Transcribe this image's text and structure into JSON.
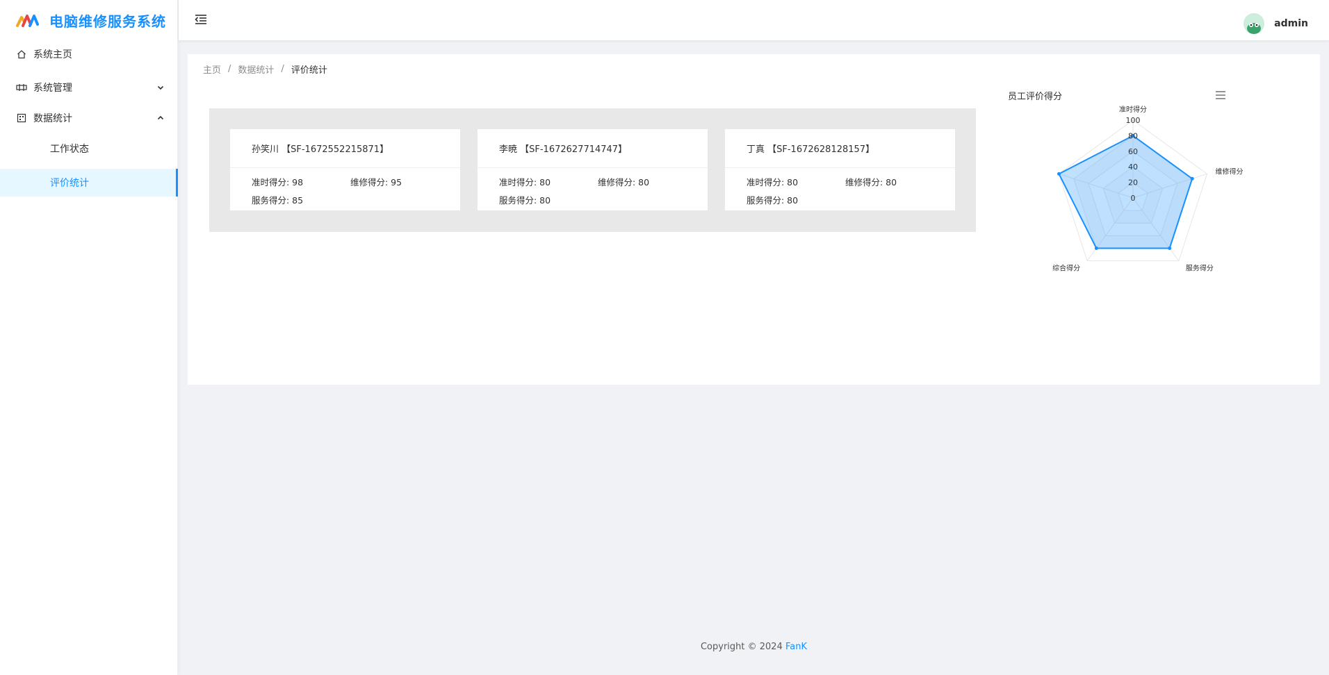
{
  "app": {
    "title": "电脑维修服务系统"
  },
  "sidebar": {
    "items": [
      {
        "label": "系统主页",
        "icon": "home-icon"
      },
      {
        "label": "系统管理",
        "icon": "settings-icon"
      },
      {
        "label": "数据统计",
        "icon": "stats-icon"
      }
    ],
    "sub_items": [
      {
        "label": "工作状态"
      },
      {
        "label": "评价统计"
      }
    ]
  },
  "header": {
    "username": "admin",
    "avatar_icon": "avatar-icon"
  },
  "breadcrumb": {
    "items": [
      "主页",
      "数据统计",
      "评价统计"
    ],
    "separator": "/"
  },
  "employees": [
    {
      "header": "孙笑川 【SF-1672552215871】",
      "ontime": "准时得分: 98",
      "repair": "维修得分: 95",
      "service": "服务得分: 85"
    },
    {
      "header": "李暁 【SF-1672627714747】",
      "ontime": "准时得分: 80",
      "repair": "维修得分: 80",
      "service": "服务得分: 80"
    },
    {
      "header": "丁真 【SF-1672628128157】",
      "ontime": "准时得分: 80",
      "repair": "维修得分: 80",
      "service": "服务得分: 80"
    }
  ],
  "chart_title": "员工评价得分",
  "chart_data": {
    "type": "radar",
    "title": "员工评价得分",
    "indicators": [
      "准时得分",
      "维修得分",
      "服务得分",
      "综合得分",
      "综合得分_hidden"
    ],
    "axis_labels": [
      "准时得分",
      "维修得分",
      "服务得分",
      "综合得分"
    ],
    "ticks": [
      "100",
      "80",
      "60",
      "40",
      "20",
      "0"
    ],
    "max": 100,
    "series": [
      {
        "values": [
          80,
          80,
          80,
          80,
          100
        ]
      }
    ],
    "color": "#1890ff"
  },
  "footer": {
    "copyright": "Copyright © 2024",
    "author": "FanK"
  },
  "colors": {
    "accent": "#1890ff",
    "active_bg": "#e6f7ff"
  }
}
